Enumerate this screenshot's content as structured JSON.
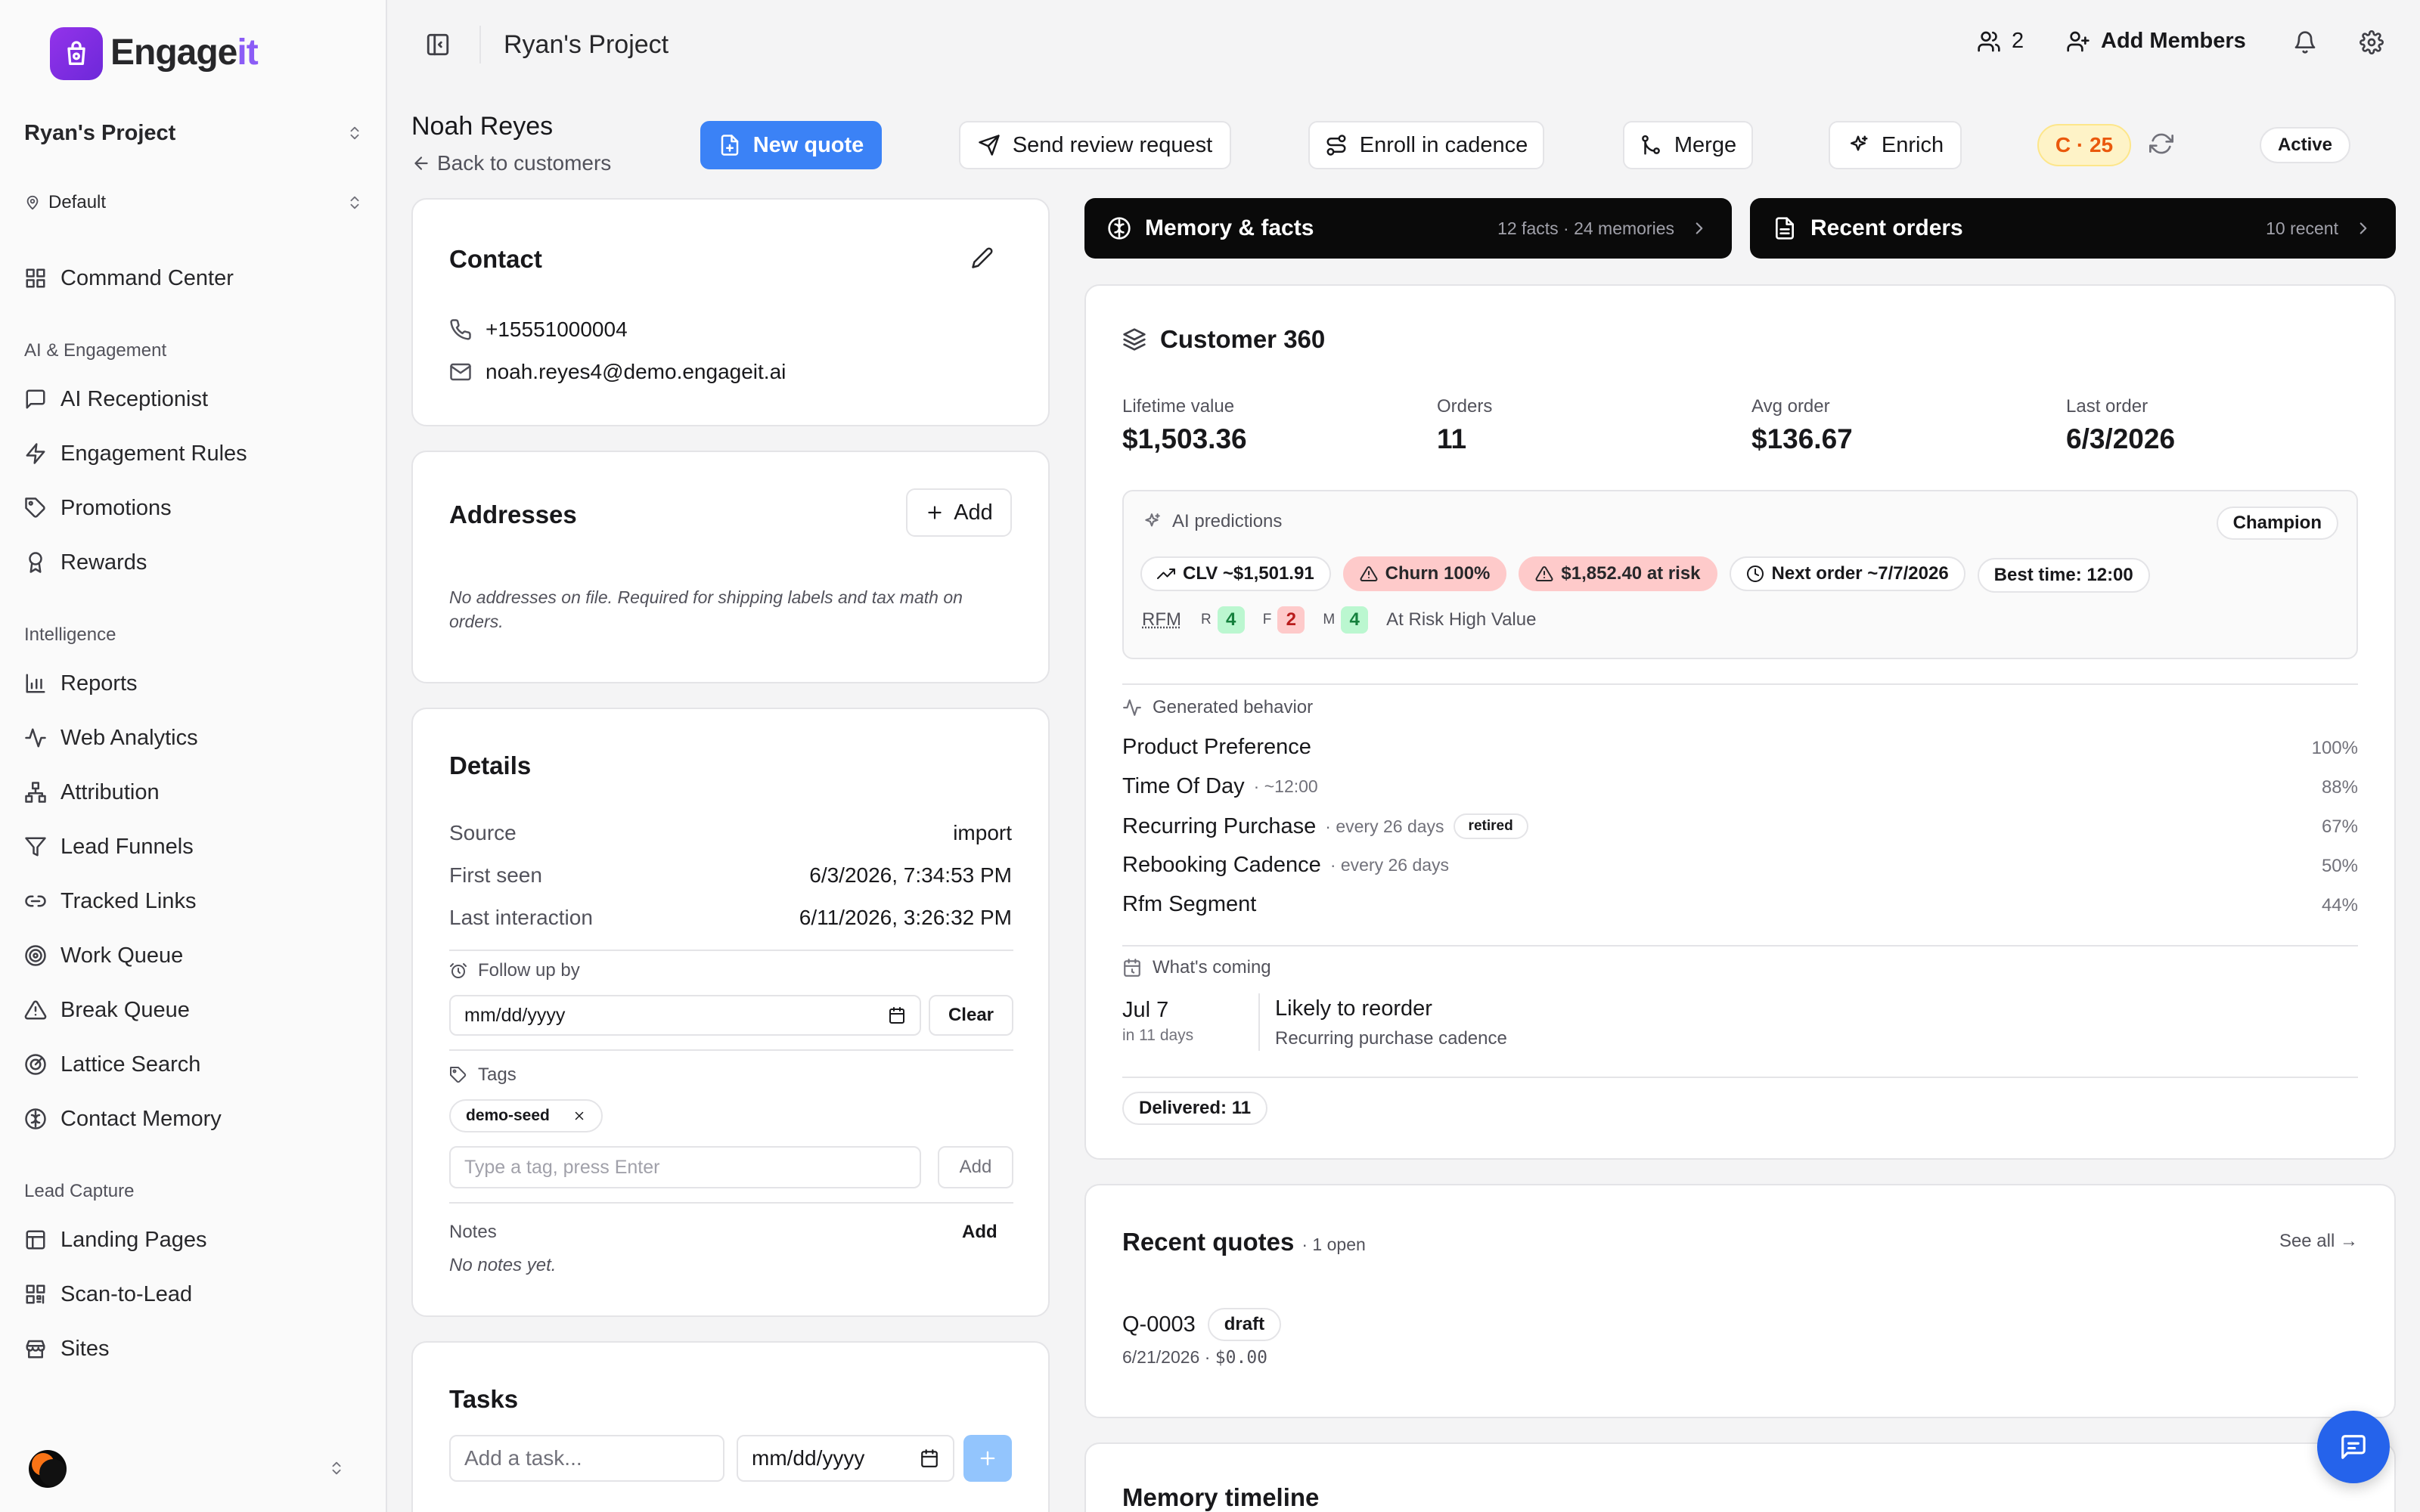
{
  "brand": {
    "name_a": "Engage",
    "name_b": "it"
  },
  "sidebar": {
    "project": "Ryan's Project",
    "location": "Default",
    "top_item": "Command Center",
    "sections": [
      {
        "heading": "AI & Engagement",
        "items": [
          "AI Receptionist",
          "Engagement Rules",
          "Promotions",
          "Rewards"
        ]
      },
      {
        "heading": "Intelligence",
        "items": [
          "Reports",
          "Web Analytics",
          "Attribution",
          "Lead Funnels",
          "Tracked Links",
          "Work Queue",
          "Break Queue",
          "Lattice Search",
          "Contact Memory"
        ]
      },
      {
        "heading": "Lead Capture",
        "items": [
          "Landing Pages",
          "Scan-to-Lead",
          "Sites"
        ]
      }
    ]
  },
  "topbar": {
    "title": "Ryan's Project",
    "member_count": "2",
    "add_members": "Add Members"
  },
  "customer": {
    "name": "Noah Reyes",
    "back": "Back to customers",
    "actions": {
      "new_quote": "New quote",
      "send_review": "Send review request",
      "enroll": "Enroll in cadence",
      "merge": "Merge",
      "enrich": "Enrich"
    },
    "score": "C · 25",
    "status": "Active"
  },
  "contact": {
    "title": "Contact",
    "phone": "+15551000004",
    "email": "noah.reyes4@demo.engageit.ai"
  },
  "addresses": {
    "title": "Addresses",
    "add": "Add",
    "empty": "No addresses on file. Required for shipping labels and tax math on orders."
  },
  "details": {
    "title": "Details",
    "rows": [
      {
        "label": "Source",
        "value": "import"
      },
      {
        "label": "First seen",
        "value": "6/3/2026, 7:34:53 PM"
      },
      {
        "label": "Last interaction",
        "value": "6/11/2026, 3:26:32 PM"
      }
    ],
    "follow_label": "Follow up by",
    "date_placeholder": "mm/dd/yyyy",
    "clear": "Clear",
    "tags_label": "Tags",
    "tag": "demo-seed",
    "tag_placeholder": "Type a tag, press Enter",
    "tag_add": "Add",
    "notes_label": "Notes",
    "notes_add": "Add",
    "notes_empty": "No notes yet."
  },
  "tasks": {
    "title": "Tasks",
    "placeholder": "Add a task...",
    "date_placeholder": "mm/dd/yyyy"
  },
  "memory_bar": {
    "title": "Memory & facts",
    "sub": "12 facts · 24 memories"
  },
  "orders_bar": {
    "title": "Recent orders",
    "sub": "10 recent"
  },
  "c360": {
    "title": "Customer 360",
    "stats": [
      {
        "label": "Lifetime value",
        "value": "$1,503.36"
      },
      {
        "label": "Orders",
        "value": "11"
      },
      {
        "label": "Avg order",
        "value": "$136.67"
      },
      {
        "label": "Last order",
        "value": "6/3/2026"
      }
    ],
    "ai_label": "AI predictions",
    "segment": "Champion",
    "pills": {
      "clv": "CLV ~$1,501.91",
      "churn": "Churn 100%",
      "risk": "$1,852.40 at risk",
      "next": "Next order ~7/7/2026",
      "best": "Best time: 12:00"
    },
    "rfm": {
      "label": "RFM",
      "r": "R",
      "r_val": "4",
      "f": "F",
      "f_val": "2",
      "m": "M",
      "m_val": "4",
      "segment": "At Risk High Value"
    },
    "behavior_label": "Generated behavior",
    "behaviors": [
      {
        "name": "Product Preference",
        "meta": "",
        "tag": "",
        "pct": "100%"
      },
      {
        "name": "Time Of Day",
        "meta": "· ~12:00",
        "tag": "",
        "pct": "88%"
      },
      {
        "name": "Recurring Purchase",
        "meta": "· every 26 days",
        "tag": "retired",
        "pct": "67%"
      },
      {
        "name": "Rebooking Cadence",
        "meta": "· every 26 days",
        "tag": "",
        "pct": "50%"
      },
      {
        "name": "Rfm Segment",
        "meta": "",
        "tag": "",
        "pct": "44%"
      }
    ],
    "coming_label": "What's coming",
    "coming": {
      "date": "Jul 7",
      "rel": "in 11 days",
      "title": "Likely to reorder",
      "sub": "Recurring purchase cadence"
    },
    "delivered": "Delivered: 11"
  },
  "quotes": {
    "title": "Recent quotes",
    "open": "· 1 open",
    "see_all": "See all →",
    "item": {
      "id": "Q-0003",
      "status": "draft",
      "date": "6/21/2026",
      "amount": "$0.00"
    }
  },
  "timeline": {
    "title": "Memory timeline"
  },
  "colors": {
    "accent": "#3b82f6",
    "brand": "#8b5cf6",
    "score": "#ea580c",
    "score_bg": "#fef3c7",
    "risk_bg": "#fecaca",
    "good_bg": "#bbf7d0"
  }
}
